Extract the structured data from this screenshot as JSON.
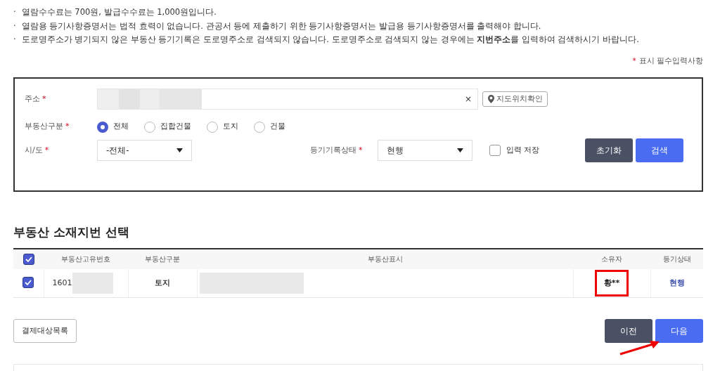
{
  "notes": [
    "열람수수료는  700원, 발급수수료는  1,000원입니다.",
    "열람용 등기사항증명서는 법적 효력이 없습니다. 관공서 등에 제출하기 위한 등기사항증명서는 발급용 등기사항증명서를 출력해야 합니다.",
    "도로명주소가 병기되지 않은 부동산 등기기록은 도로명주소로 검색되지 않습니다. 도로명주소로 검색되지 않는 경우에는 **지번주소**를 입력하여 검색하시기 바랍니다."
  ],
  "note_bullet": "·",
  "required_legend": {
    "mark": "*",
    "text": "표시 필수입력사항"
  },
  "form": {
    "address": {
      "label": "주소",
      "mark": "*",
      "clear": "×",
      "map_button": "지도위치확인"
    },
    "property_type": {
      "label": "부동산구분",
      "mark": "*",
      "options": [
        {
          "label": "전체",
          "selected": true
        },
        {
          "label": "집합건물",
          "selected": false
        },
        {
          "label": "토지",
          "selected": false
        },
        {
          "label": "건물",
          "selected": false
        }
      ]
    },
    "region": {
      "label": "시/도",
      "mark": "*",
      "value": "-전체-"
    },
    "record_status": {
      "label": "등기기록상태",
      "mark": "*",
      "value": "현행"
    },
    "save_input": {
      "label": "입력 저장",
      "checked": false
    },
    "buttons": {
      "reset": "초기화",
      "search": "검색"
    }
  },
  "section_title": "부동산 소재지번 선택",
  "table": {
    "header_checked": true,
    "columns": [
      "부동산고유번호",
      "부동산구분",
      "부동산표시",
      "소유자",
      "등기상태"
    ],
    "rows": [
      {
        "checked": true,
        "id": "1601",
        "type": "토지",
        "owner": "황**",
        "owner_highlighted": true,
        "status": "현행"
      }
    ]
  },
  "buttons": {
    "list": "결제대상목록",
    "prev": "이전",
    "next": "다음"
  }
}
